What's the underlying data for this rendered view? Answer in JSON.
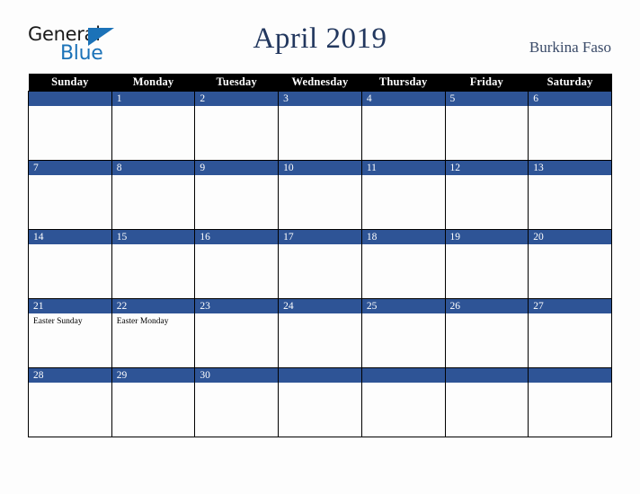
{
  "logo": {
    "text_primary": "General",
    "text_secondary": "Blue",
    "primary_color": "#1a1a1a",
    "secondary_color": "#1b72b8"
  },
  "header": {
    "title": "April 2019",
    "country": "Burkina Faso",
    "title_color": "#22375e"
  },
  "calendar": {
    "accent_color": "#2e5496",
    "header_bg": "#000000",
    "weekday_headers": [
      "Sunday",
      "Monday",
      "Tuesday",
      "Wednesday",
      "Thursday",
      "Friday",
      "Saturday"
    ],
    "weeks": [
      [
        {
          "day": "",
          "events": []
        },
        {
          "day": "1",
          "events": []
        },
        {
          "day": "2",
          "events": []
        },
        {
          "day": "3",
          "events": []
        },
        {
          "day": "4",
          "events": []
        },
        {
          "day": "5",
          "events": []
        },
        {
          "day": "6",
          "events": []
        }
      ],
      [
        {
          "day": "7",
          "events": []
        },
        {
          "day": "8",
          "events": []
        },
        {
          "day": "9",
          "events": []
        },
        {
          "day": "10",
          "events": []
        },
        {
          "day": "11",
          "events": []
        },
        {
          "day": "12",
          "events": []
        },
        {
          "day": "13",
          "events": []
        }
      ],
      [
        {
          "day": "14",
          "events": []
        },
        {
          "day": "15",
          "events": []
        },
        {
          "day": "16",
          "events": []
        },
        {
          "day": "17",
          "events": []
        },
        {
          "day": "18",
          "events": []
        },
        {
          "day": "19",
          "events": []
        },
        {
          "day": "20",
          "events": []
        }
      ],
      [
        {
          "day": "21",
          "events": [
            "Easter Sunday"
          ]
        },
        {
          "day": "22",
          "events": [
            "Easter Monday"
          ]
        },
        {
          "day": "23",
          "events": []
        },
        {
          "day": "24",
          "events": []
        },
        {
          "day": "25",
          "events": []
        },
        {
          "day": "26",
          "events": []
        },
        {
          "day": "27",
          "events": []
        }
      ],
      [
        {
          "day": "28",
          "events": []
        },
        {
          "day": "29",
          "events": []
        },
        {
          "day": "30",
          "events": []
        },
        {
          "day": "",
          "events": []
        },
        {
          "day": "",
          "events": []
        },
        {
          "day": "",
          "events": []
        },
        {
          "day": "",
          "events": []
        }
      ]
    ]
  }
}
